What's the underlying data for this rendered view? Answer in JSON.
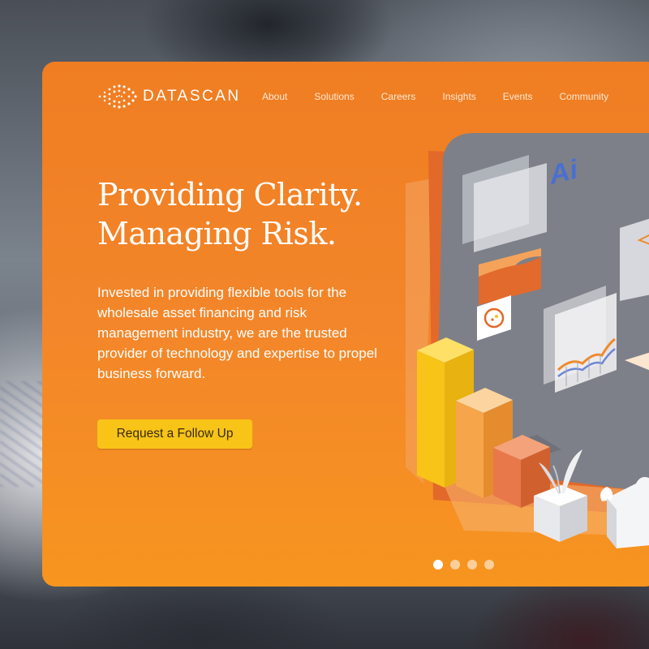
{
  "brand": {
    "name": "DATASCAN",
    "logo_icon": "dotted-sphere-logo"
  },
  "nav": {
    "items": [
      {
        "label": "About"
      },
      {
        "label": "Solutions"
      },
      {
        "label": "Careers"
      },
      {
        "label": "Insights"
      },
      {
        "label": "Events"
      },
      {
        "label": "Community"
      }
    ]
  },
  "hero": {
    "headline_line1": "Providing Clarity.",
    "headline_line2": "Managing Risk.",
    "description": "Invested in providing flexible tools for the wholesale asset financing and risk management industry, we are the trusted provider of technology and expertise to propel business forward.",
    "cta_label": "Request a Follow Up",
    "illustration": {
      "badge_text": "Ai"
    }
  },
  "carousel": {
    "slide_count": 4,
    "active_index": 0
  },
  "colors": {
    "card_orange": "#f07d22",
    "cta_yellow": "#f7c417",
    "text_white": "#ffffff"
  }
}
